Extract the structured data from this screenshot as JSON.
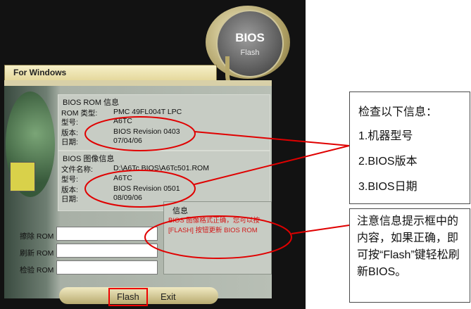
{
  "window": {
    "title": "For Windows",
    "badge_title": "BIOS",
    "badge_subtitle": "Flash"
  },
  "rom_info": {
    "title": "BIOS ROM 信息",
    "rows": [
      {
        "label": "ROM 类型:",
        "value": "PMC 49FL004T LPC"
      },
      {
        "label": "型号:",
        "value": "A6TC"
      },
      {
        "label": "版本:",
        "value": "BIOS Revision 0403"
      },
      {
        "label": "日期:",
        "value": "07/04/06"
      }
    ]
  },
  "image_info": {
    "title": "BIOS 图像信息",
    "rows": [
      {
        "label": "文件名称:",
        "value": "D:\\A6Tc BIOS\\A6Tc501.ROM"
      },
      {
        "label": "型号:",
        "value": "A6TC"
      },
      {
        "label": "版本:",
        "value": "BIOS Revision 0501"
      },
      {
        "label": "日期:",
        "value": "08/09/06"
      }
    ]
  },
  "actions": {
    "erase_label": "擦除 ROM",
    "flash_label": "刷新 ROM",
    "verify_label": "检验 ROM"
  },
  "message": {
    "title": "信息",
    "text": "BIOS 图像格式正确，您可以按 [FLASH] 按钮更新 BIOS ROM"
  },
  "buttons": {
    "flash": "Flash",
    "exit": "Exit"
  },
  "callouts": {
    "check_title": "检查以下信息：",
    "check_items": [
      "1.机器型号",
      "2.BIOS版本",
      "3.BIOS日期"
    ],
    "note": "注意信息提示框中的内容，如果正确，即可按“Flash”键轻松刷新BIOS。"
  },
  "colors": {
    "annotation_red": "#e00000",
    "message_red": "#d21818"
  }
}
